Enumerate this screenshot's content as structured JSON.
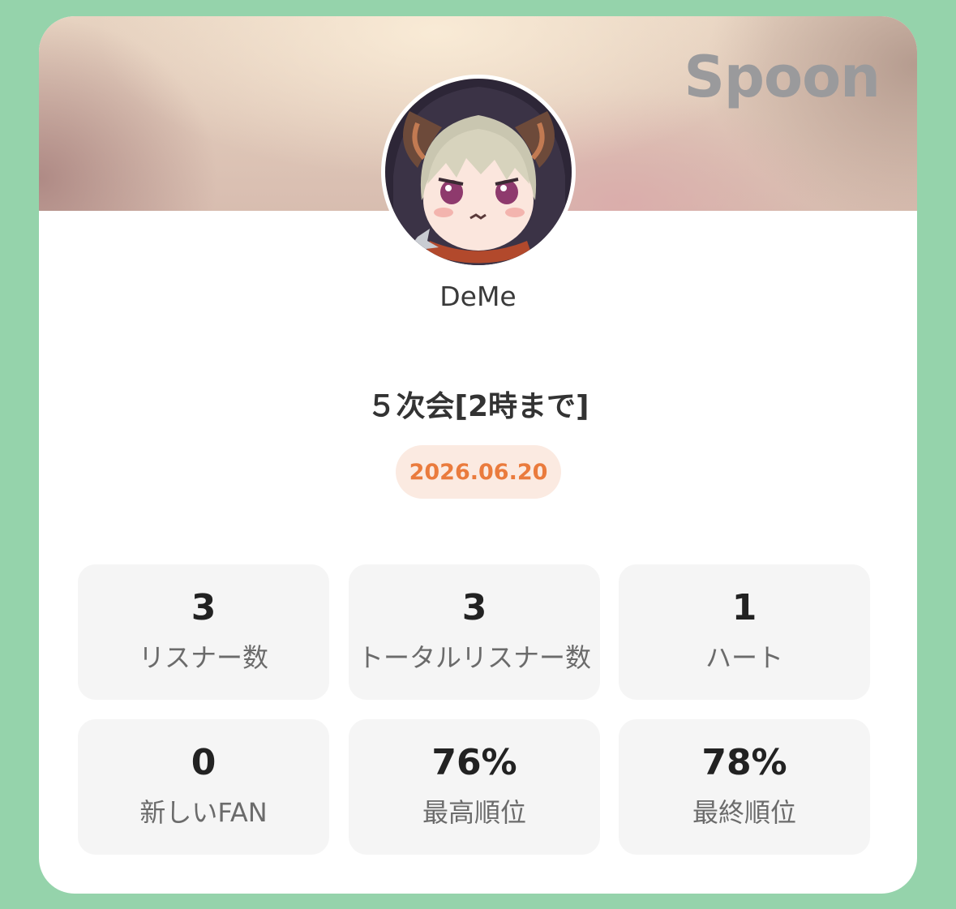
{
  "brand": "Spoon",
  "profile": {
    "username": "DeMe"
  },
  "broadcast": {
    "title": "５次会[2時まで]",
    "date": "2026.06.20"
  },
  "stats": [
    {
      "value": "3",
      "label": "リスナー数"
    },
    {
      "value": "3",
      "label": "トータルリスナー数"
    },
    {
      "value": "1",
      "label": "ハート"
    },
    {
      "value": "0",
      "label": "新しいFAN"
    },
    {
      "value": "76%",
      "label": "最高順位"
    },
    {
      "value": "78%",
      "label": "最終順位"
    }
  ],
  "colors": {
    "background": "#95d3ab",
    "accent": "#ea7b3d",
    "badge_bg": "#fbeae1",
    "tile_bg": "#f5f5f5"
  }
}
